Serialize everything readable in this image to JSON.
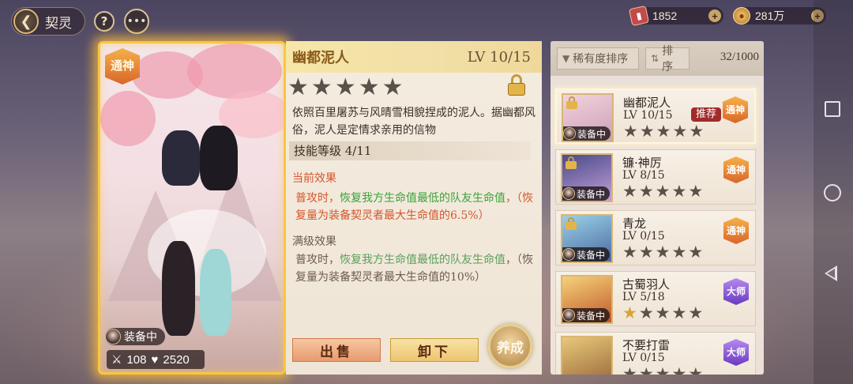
{
  "topbar": {
    "title": "契灵",
    "back_icon": "chevron-left-icon",
    "help_label": "?",
    "chat_icon": "chat-bubble-icon",
    "chat_glyph": "•••",
    "ticket_count": "1852",
    "gold_count": "281万",
    "plus_label": "+"
  },
  "card": {
    "tier": "通神",
    "equip_label": "装备中",
    "attack": "108",
    "hp": "2520",
    "attack_icon": "sword-icon",
    "hp_icon": "heart-icon"
  },
  "detail": {
    "name": "幽都泥人",
    "level": "LV 10/15",
    "stars_total": 5,
    "stars_filled": 0,
    "star_glyph": "★",
    "description": "依照百里屠苏与风晴雪相貌捏成的泥人。据幽都风俗，泥人是定情求亲用的信物",
    "skill_level": "技能等级 4/11",
    "current_title": "当前效果",
    "current_effect_a": "普攻时，",
    "current_effect_green": "恢复我方生命值最低的队友生命值",
    "current_effect_b": "，（恢复量为装备契灵者最大生命值的6.5%）",
    "max_title": "满级效果",
    "max_effect_a": "普攻时，",
    "max_effect_green": "恢复我方生命值最低的队友生命值",
    "max_effect_b": "，（恢复量为装备契灵者最大生命值的10%）",
    "sell_label": "出售",
    "unload_label": "卸下",
    "train_label": "养成"
  },
  "list": {
    "sort_rarity_label": "稀有度排序",
    "sort_order_label": "排序",
    "count": "32/1000",
    "items": [
      {
        "name": "幽都泥人",
        "level": "LV 10/15",
        "tier": "通神",
        "equip": "装备中",
        "recommend": "推荐",
        "stars_on": 0,
        "locked": true
      },
      {
        "name": "镰·神厉",
        "level": "LV 8/15",
        "tier": "通神",
        "equip": "装备中",
        "stars_on": 0,
        "locked": true
      },
      {
        "name": "青龙",
        "level": "LV 0/15",
        "tier": "通神",
        "equip": "装备中",
        "stars_on": 0,
        "locked": true
      },
      {
        "name": "古蜀羽人",
        "level": "LV 5/18",
        "tier": "大师",
        "equip": "装备中",
        "stars_on": 1,
        "locked": false
      },
      {
        "name": "不要打雷",
        "level": "LV 0/15",
        "tier": "大师",
        "equip": "",
        "stars_on": 0,
        "locked": false
      }
    ]
  },
  "colors": {
    "accent_gold": "#f7c642",
    "effect_red": "#d4572c",
    "effect_green": "#3aa23a"
  }
}
